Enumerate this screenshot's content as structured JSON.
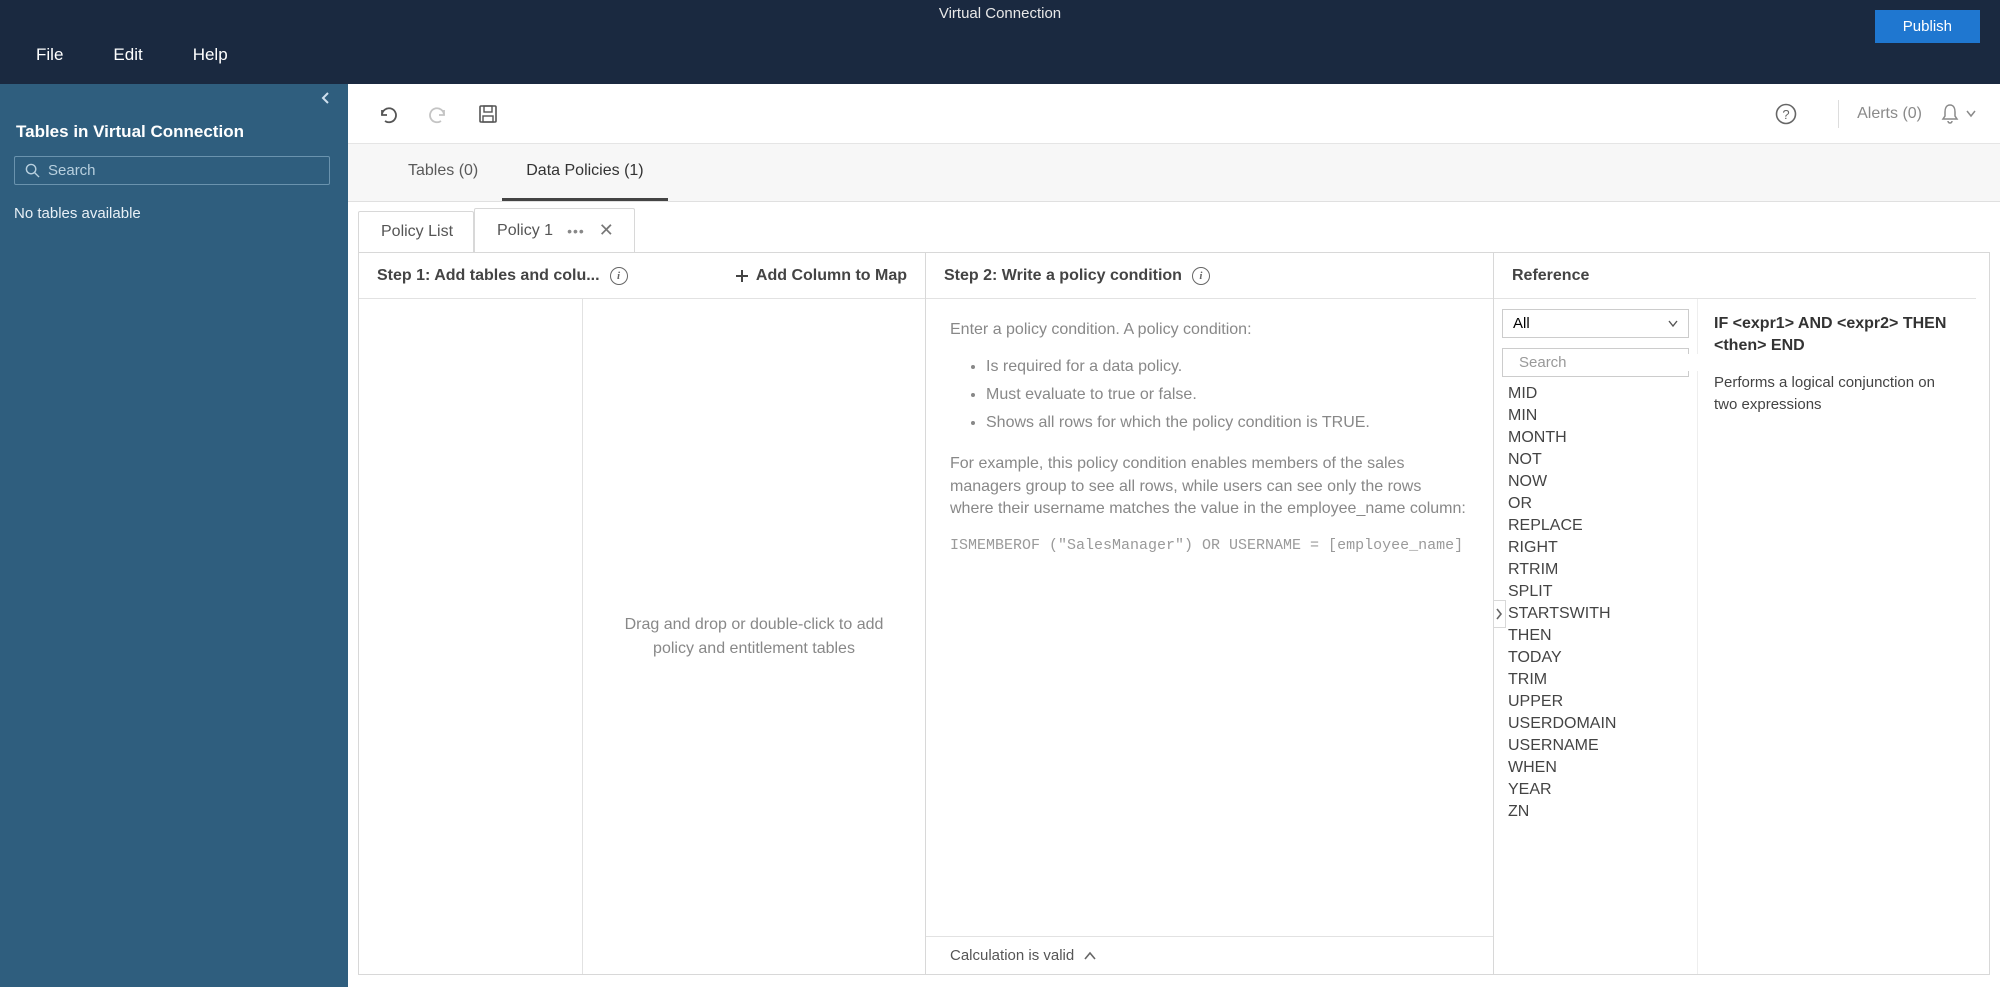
{
  "app": {
    "title": "Virtual Connection"
  },
  "menu": {
    "file": "File",
    "edit": "Edit",
    "help": "Help",
    "publish": "Publish"
  },
  "sidebar": {
    "heading": "Tables in Virtual Connection",
    "search_placeholder": "Search",
    "empty": "No tables available"
  },
  "toolbar": {
    "alerts": "Alerts (0)"
  },
  "subtabs": {
    "tables": "Tables (0)",
    "policies": "Data Policies (1)"
  },
  "policy_tabs": {
    "list": "Policy List",
    "current": "Policy 1"
  },
  "step1": {
    "title": "Step 1: Add tables and colu...",
    "add_column": "Add Column to Map",
    "drop_hint": "Drag and drop or double-click to add policy and entitlement tables"
  },
  "step2": {
    "title": "Step 2: Write a policy condition",
    "intro": "Enter a policy condition. A policy condition:",
    "bullets": [
      "Is required for a data policy.",
      "Must evaluate to true or false.",
      "Shows all rows for which the policy condition is TRUE."
    ],
    "example_intro": "For example, this policy condition enables members of the sales managers group to see all rows, while users can see only the rows where their username matches the value in the employee_name column:",
    "code": "ISMEMBEROF (\"SalesManager\") OR USERNAME = [employee_name]",
    "footer": "Calculation is valid"
  },
  "reference": {
    "header": "Reference",
    "filter": "All",
    "search_placeholder": "Search",
    "functions": [
      "MID",
      "MIN",
      "MONTH",
      "NOT",
      "NOW",
      "OR",
      "REPLACE",
      "RIGHT",
      "RTRIM",
      "SPLIT",
      "STARTSWITH",
      "THEN",
      "TODAY",
      "TRIM",
      "UPPER",
      "USERDOMAIN",
      "USERNAME",
      "WHEN",
      "YEAR",
      "ZN"
    ],
    "syntax": "IF <expr1> AND <expr2> THEN <then> END",
    "description": "Performs a logical conjunction on two expressions"
  }
}
